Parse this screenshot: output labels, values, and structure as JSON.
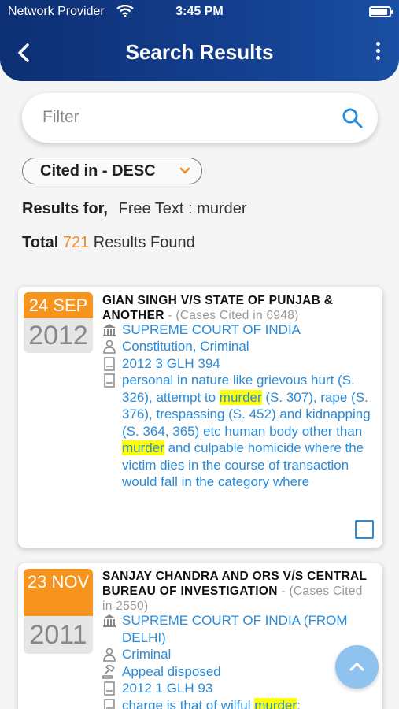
{
  "status_bar": {
    "provider": "Network Provider",
    "time": "3:45 PM"
  },
  "nav": {
    "title": "Search Results"
  },
  "filter": {
    "placeholder": "Filter"
  },
  "sort": {
    "label": "Cited in - DESC"
  },
  "results": {
    "label": "Results for,",
    "query": "Free Text : murder",
    "total_label": "Total",
    "total_count": "721",
    "total_suffix": "Results Found"
  },
  "cards": [
    {
      "month_day": "24 SEP",
      "year": "2012",
      "title": "GIAN SINGH V/S STATE OF PUNJAB & ANOTHER",
      "cited": "- (Cases Cited in 6948)",
      "court": "SUPREME COURT OF INDIA",
      "category": "Constitution, Criminal",
      "citation": "2012 3 GLH 394",
      "snippet_parts": [
        "personal in nature like grievous hurt (S. 326), attempt to ",
        "murder",
        " (S. 307), rape (S. 376), trespassing (S. 452) and kidnapping (S. 364, 365) etc human body other than ",
        "murder",
        " and culpable homicide where the victim dies in the course of transaction would fall in the category where"
      ]
    },
    {
      "month_day": "23 NOV",
      "year": "2011",
      "title": "SANJAY CHANDRA AND ORS V/S CENTRAL BUREAU OF INVESTIGATION",
      "cited": "- (Cases Cited in 2550)",
      "court": "SUPREME COURT OF INDIA (FROM DELHI)",
      "category": "Criminal",
      "disposition": "Appeal disposed",
      "citation": "2012 1 GLH 93",
      "snippet_parts": [
        "charge is that of wilful ",
        "murder",
        ";"
      ]
    }
  ],
  "colors": {
    "header": "#0d2f73",
    "accent": "#f7941d",
    "link": "#2a8bd8",
    "highlight": "#ffff00"
  },
  "icons": [
    "back-arrow-icon",
    "more-vertical-icon",
    "search-icon",
    "chevron-down-icon",
    "court-icon",
    "category-icon",
    "citation-icon",
    "snippet-icon",
    "gavel-icon",
    "scroll-top-icon"
  ]
}
